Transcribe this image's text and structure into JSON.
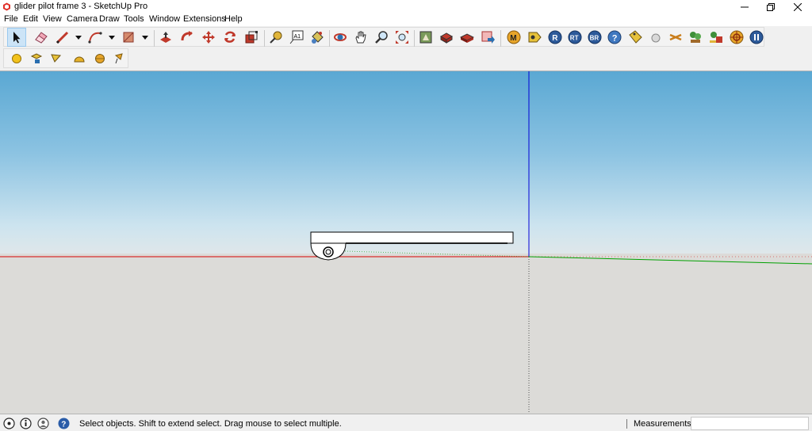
{
  "window": {
    "title": "glider pilot frame 3 - SketchUp Pro"
  },
  "menu": {
    "items": [
      "File",
      "Edit",
      "View",
      "Camera",
      "Draw",
      "Tools",
      "Window",
      "Extensions",
      "Help"
    ]
  },
  "toolbar": {
    "active_tool": "select",
    "tools": [
      "select",
      "eraser",
      "pencil",
      "arc",
      "rectangle",
      "push-pull",
      "follow-me",
      "move",
      "rotate",
      "scale",
      "tape-measure",
      "text",
      "paint-bucket",
      "orbit",
      "pan",
      "zoom",
      "zoom-extents",
      "warehouse",
      "components",
      "extension-warehouse",
      "send-to-layout",
      "plugin-m",
      "plugin-glasses",
      "plugin-r",
      "plugin-rt",
      "plugin-br",
      "help",
      "tag",
      "sphere",
      "plugin-x",
      "plugin-tree",
      "plugin-landscape",
      "target",
      "pause"
    ],
    "sub_tools": [
      "sun",
      "location",
      "sandbox",
      "dome",
      "sphere",
      "flag"
    ]
  },
  "viewport": {
    "sky_color": "#5aa8d3",
    "ground_color": "#dcdbd8",
    "axes": {
      "red": "#d60000",
      "green": "#00a000",
      "blue": "#0000d6"
    }
  },
  "statusbar": {
    "message": "Select objects. Shift to extend select. Drag mouse to select multiple.",
    "measurements_label": "Measurements",
    "measurements_value": ""
  }
}
